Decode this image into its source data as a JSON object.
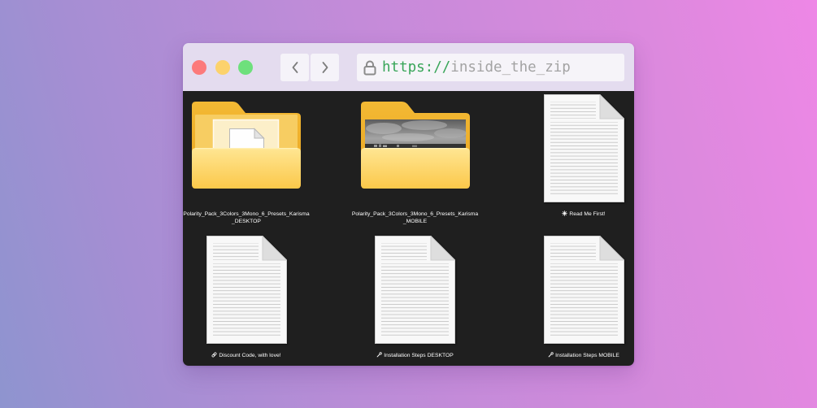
{
  "window": {
    "traffic_lights": {
      "close": "#fc7a7b",
      "minimize": "#fcd26c",
      "maximize": "#6ee07c"
    },
    "nav": {
      "back_icon": "chevron-left-icon",
      "forward_icon": "chevron-right-icon"
    },
    "address": {
      "lock_icon": "lock-icon",
      "scheme": "https://",
      "path": "inside_the_zip",
      "scheme_color": "#38a558",
      "path_color": "#a3a3a3"
    }
  },
  "files": [
    {
      "icon": "folder-with-document-icon",
      "name_lines": [
        "Polarity_Pack_3Colors_3Mono_6_Presets_Karisma",
        "_DESKTOP"
      ]
    },
    {
      "icon": "folder-with-photo-icon",
      "name_lines": [
        "Polarity_Pack_3Colors_3Mono_6_Presets_Karisma",
        "_MOBILE"
      ]
    },
    {
      "icon": "document-icon",
      "label_icon": "sparkle-icon",
      "name": "Read Me First!"
    },
    {
      "icon": "document-icon",
      "label_icon": "link-icon",
      "name": "Discount Code, with love!"
    },
    {
      "icon": "document-icon",
      "label_icon": "wrench-icon",
      "name": "Installation Steps DESKTOP"
    },
    {
      "icon": "document-icon",
      "label_icon": "wrench-icon",
      "name": "Installation Steps MOBILE"
    }
  ],
  "colors": {
    "titlebar": "#e4dcef",
    "content_background": "#1f1f1f",
    "label_text": "#ffffff"
  }
}
